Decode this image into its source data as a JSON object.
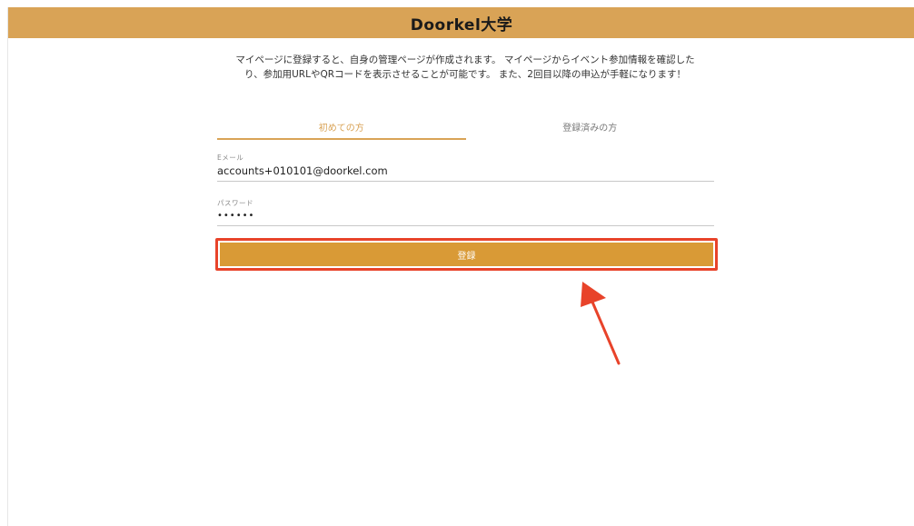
{
  "header": {
    "title": "Doorkel大学"
  },
  "intro": {
    "line1": "マイページに登録すると、自身の管理ページが作成されます。 マイページからイベント参加情報を確認した",
    "line2": "り、参加用URLやQRコードを表示させることが可能です。 また、2回目以降の申込が手軽になります！"
  },
  "tabs": [
    {
      "label": "初めての方",
      "active": true
    },
    {
      "label": "登録済みの方",
      "active": false
    }
  ],
  "form": {
    "email_label": "Eメール",
    "email_value": "accounts+010101@doorkel.com",
    "password_label": "パスワード",
    "password_value": "••••••"
  },
  "register_button": {
    "label": "登録"
  },
  "colors": {
    "header_bg": "#d9a356",
    "accent": "#d9a356",
    "button_bg": "#d99a36",
    "highlight": "#e8432a"
  },
  "annotations": {
    "arrow": "red-arrow-icon"
  }
}
